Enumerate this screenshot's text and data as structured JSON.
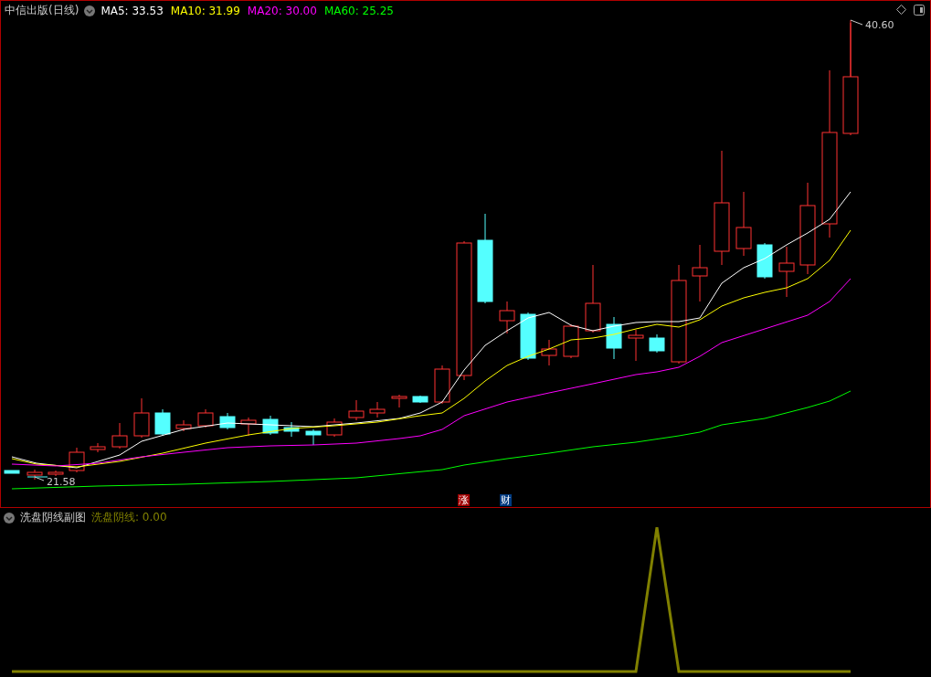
{
  "stock": {
    "title": "中信出版(日线)",
    "ma": [
      {
        "label": "MA5: 33.53",
        "color": "#ffffff"
      },
      {
        "label": "MA10: 31.99",
        "color": "#ffff00"
      },
      {
        "label": "MA20: 30.00",
        "color": "#ff00ff"
      },
      {
        "label": "MA60: 25.25",
        "color": "#00ff00"
      }
    ]
  },
  "main_chart": {
    "high_label": "40.60",
    "low_label": "21.58",
    "markers": [
      {
        "text": "涨",
        "color": "#a00000"
      },
      {
        "text": "财",
        "color": "#003a80"
      }
    ]
  },
  "sub_chart": {
    "title": "洗盘阴线副图",
    "indicator": "洗盘阴线: 0.00"
  }
}
